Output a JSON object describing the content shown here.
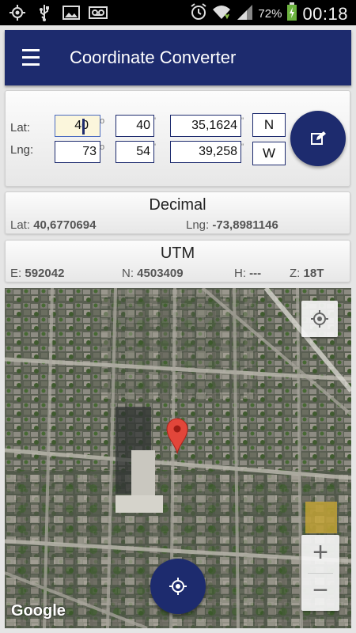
{
  "status_bar": {
    "battery": "72%",
    "time": "00:18",
    "icons": [
      "gps-icon",
      "usb-icon",
      "picture-icon",
      "voicemail-icon",
      "alarm-icon",
      "wifi-icon",
      "signal-icon",
      "battery-charging-icon"
    ]
  },
  "app_bar": {
    "title": "Coordinate Converter",
    "menu_icon": "hamburger-menu-icon"
  },
  "dms": {
    "lat_label": "Lat:",
    "lng_label": "Lng:",
    "lat": {
      "deg": "40",
      "min": "40",
      "sec": "35,1624",
      "dir": "N"
    },
    "lng": {
      "deg": "73",
      "min": "54",
      "sec": "39,258",
      "dir": "W"
    },
    "unit_deg": "o",
    "unit_min": "'",
    "unit_sec": "''",
    "edit_icon": "edit-icon"
  },
  "decimal": {
    "title": "Decimal",
    "lat_label": "Lat:",
    "lat_value": "40,6770694",
    "lng_label": "Lng:",
    "lng_value": "-73,8981146"
  },
  "utm": {
    "title": "UTM",
    "e_label": "E:",
    "e_value": "592042",
    "n_label": "N:",
    "n_value": "4503409",
    "h_label": "H:",
    "h_value": "---",
    "z_label": "Z:",
    "z_value": "18T"
  },
  "map": {
    "attribution": "Google",
    "zoom_in": "+",
    "zoom_out": "−",
    "my_location_icon": "my-location-icon",
    "pin_icon": "map-pin-icon"
  },
  "colors": {
    "primary": "#1d2b6e",
    "pin": "#e2463a"
  }
}
